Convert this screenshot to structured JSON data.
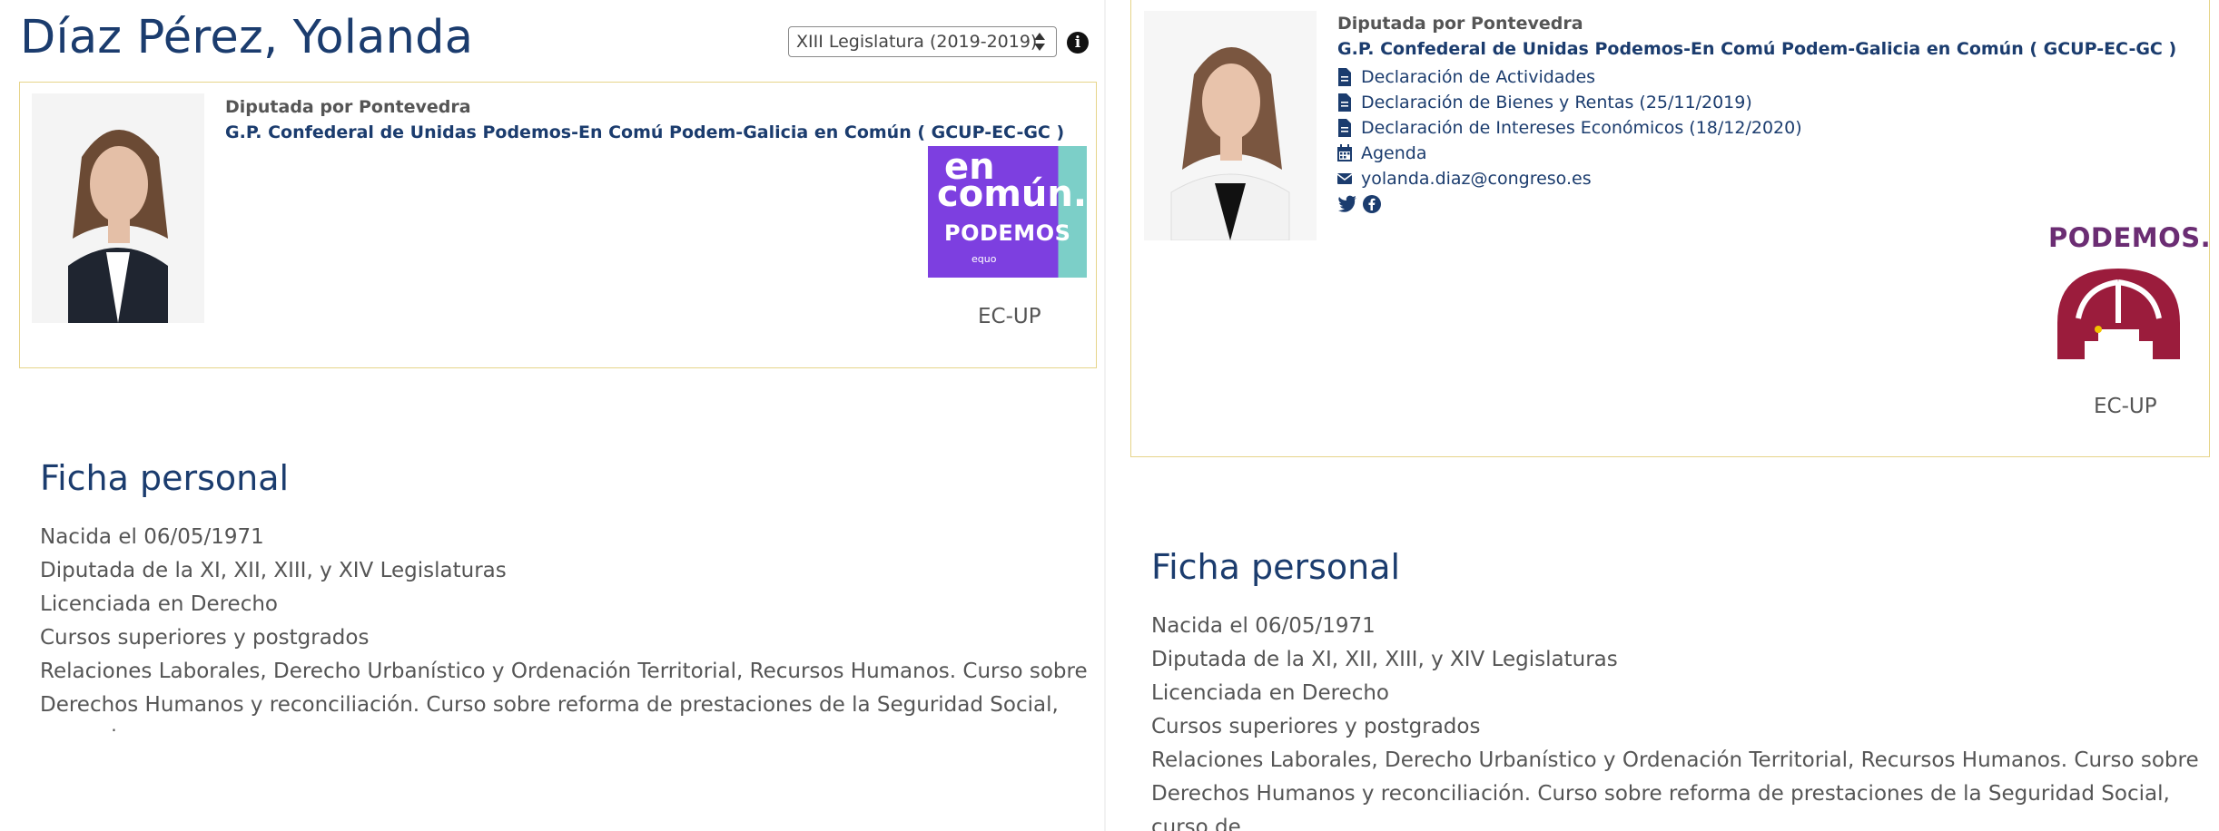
{
  "deputy": {
    "name": "Díaz Pérez, Yolanda",
    "constituency": "Diputada por Pontevedra",
    "group": "G.P. Confederal de Unidas Podemos-En Comú Podem-Galicia en Común ( GCUP-EC-GC )",
    "party_acronym": "EC-UP",
    "legislature_selected": "XIII Legislatura (2019-2019)",
    "links": [
      {
        "label": "Declaración de Actividades",
        "icon": "file-icon"
      },
      {
        "label": "Declaración de Bienes y Rentas (25/11/2019)",
        "icon": "file-icon"
      },
      {
        "label": "Declaración de Intereses Económicos (18/12/2020)",
        "icon": "file-icon"
      },
      {
        "label": "Agenda",
        "icon": "calendar-icon"
      },
      {
        "label": "yolanda.diaz@congreso.es",
        "icon": "envelope-icon"
      }
    ],
    "social": [
      "twitter-icon",
      "facebook-icon"
    ]
  },
  "logo_encomun": {
    "line1": "en",
    "line2": "común.",
    "line3": "PODEMOS",
    "line4": "equo"
  },
  "logo_podemos": {
    "word": "PODEMOS."
  },
  "ficha": {
    "title": "Ficha personal",
    "lines": [
      "Nacida el 06/05/1971",
      "Diputada de la XI, XII, XIII, y XIV Legislaturas",
      "Licenciada en Derecho",
      "Cursos superiores y postgrados",
      "Relaciones Laborales, Derecho Urbanístico y Ordenación Territorial, Recursos Humanos. Curso sobre",
      "Derechos Humanos y reconciliación. Curso sobre reforma de prestaciones de la Seguridad Social, curso de"
    ]
  },
  "colors": {
    "accent": "#1b3c6e",
    "card_border": "#e6d48a",
    "podemos_purple": "#6b2d73",
    "podemos_red": "#9b1c3c",
    "encomun_purple": "#7d3fe0",
    "encomun_teal": "#7ccfc8"
  }
}
